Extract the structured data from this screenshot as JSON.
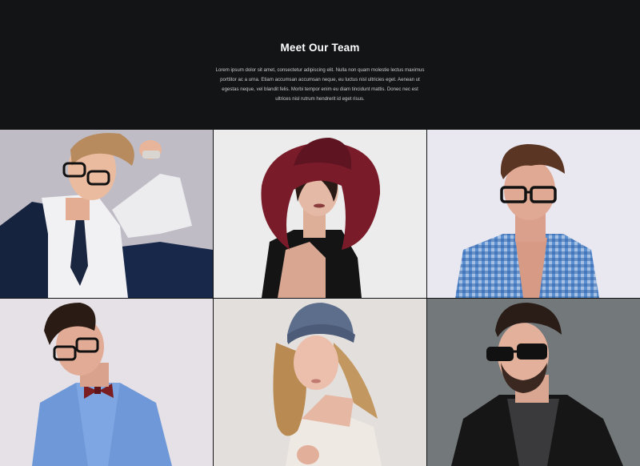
{
  "section": {
    "title": "Meet Our Team",
    "description": "Lorem ipsum dolor sit amet, consectetur adipiscing elit. Nulla non quam molestie lectus maximus porttitor ac a urna. Etiam accumsan accumsan neque, eu luctus nisl ultricies eget. Aenean ut egestas neque, vel blandit felis. Morbi tempor enim eu diam tincidunt mattis. Donec nec est ultrices nisl rutrum hendrerit id eget risus."
  },
  "team": [
    {
      "photo": "man-with-glasses-and-tie-photo"
    },
    {
      "photo": "woman-in-burgundy-hat-photo"
    },
    {
      "photo": "man-in-plaid-shirt-with-glasses-photo"
    },
    {
      "photo": "man-with-bowtie-and-glasses-photo"
    },
    {
      "photo": "woman-in-knit-beanie-photo"
    },
    {
      "photo": "man-in-leather-jacket-with-sunglasses-photo"
    }
  ],
  "colors": {
    "header_background": "#131416",
    "title": "#ffffff",
    "description": "#c8c9cc"
  }
}
